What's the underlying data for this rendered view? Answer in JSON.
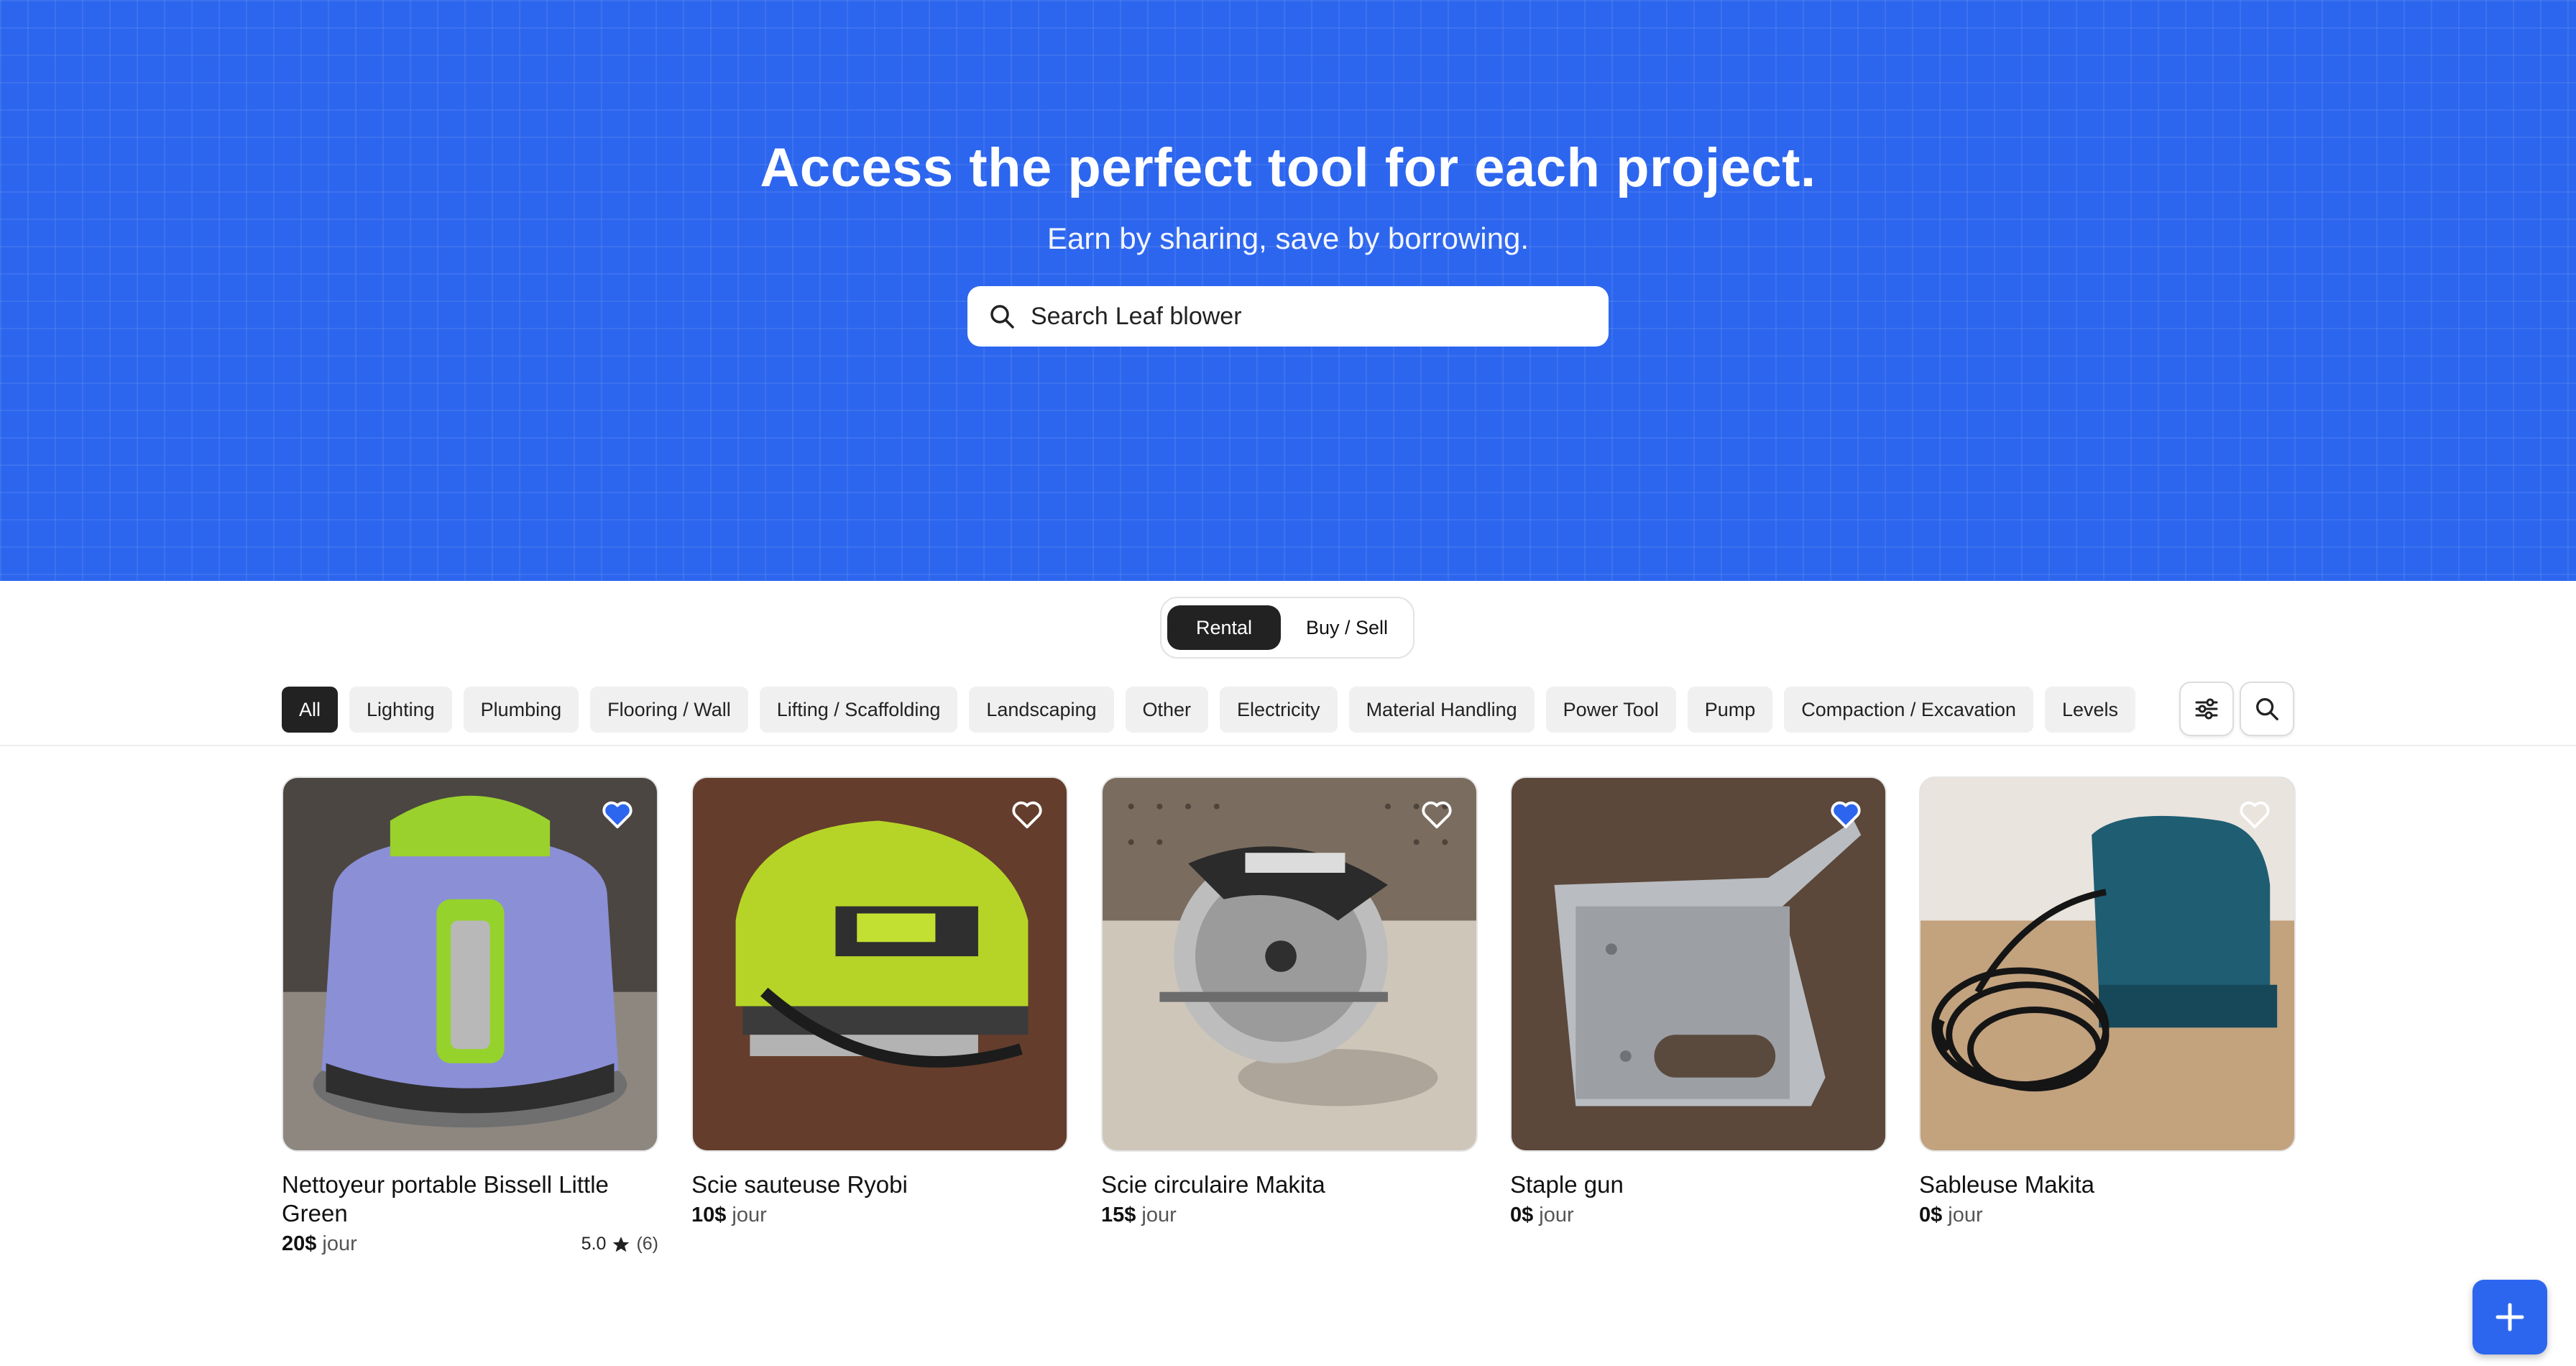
{
  "hero": {
    "title": "Access the perfect tool for each project.",
    "subtitle": "Earn by sharing, save by borrowing.",
    "search_label": "Search",
    "search_value": "Leaf blower",
    "background_color": "#2d66ee"
  },
  "mode_toggle": {
    "options": [
      "Rental",
      "Buy / Sell"
    ],
    "selected": "Rental"
  },
  "categories": {
    "selected": "All",
    "items": [
      "All",
      "Lighting",
      "Plumbing",
      "Flooring / Wall",
      "Lifting / Scaffolding",
      "Landscaping",
      "Other",
      "Electricity",
      "Material Handling",
      "Power Tool",
      "Pump",
      "Compaction / Excavation",
      "Levels"
    ]
  },
  "toolbar": {
    "filter_icon": "sliders-icon",
    "search_icon": "search-icon"
  },
  "listings": [
    {
      "title": "Nettoyeur portable Bissell Little Green",
      "price": "20$",
      "unit": "jour",
      "rating": "5.0",
      "reviews": "(6)",
      "favorited": true
    },
    {
      "title": "Scie sauteuse Ryobi",
      "price": "10$",
      "unit": "jour",
      "favorited": false
    },
    {
      "title": "Scie circulaire Makita",
      "price": "15$",
      "unit": "jour",
      "favorited": false
    },
    {
      "title": "Staple gun",
      "price": "0$",
      "unit": "jour",
      "favorited": true
    },
    {
      "title": "Sableuse Makita",
      "price": "0$",
      "unit": "jour",
      "favorited": false
    }
  ],
  "fab": {
    "icon": "plus-icon"
  },
  "colors": {
    "accent": "#2d66ee",
    "dark": "#222222",
    "chip": "#f0f0f0"
  }
}
